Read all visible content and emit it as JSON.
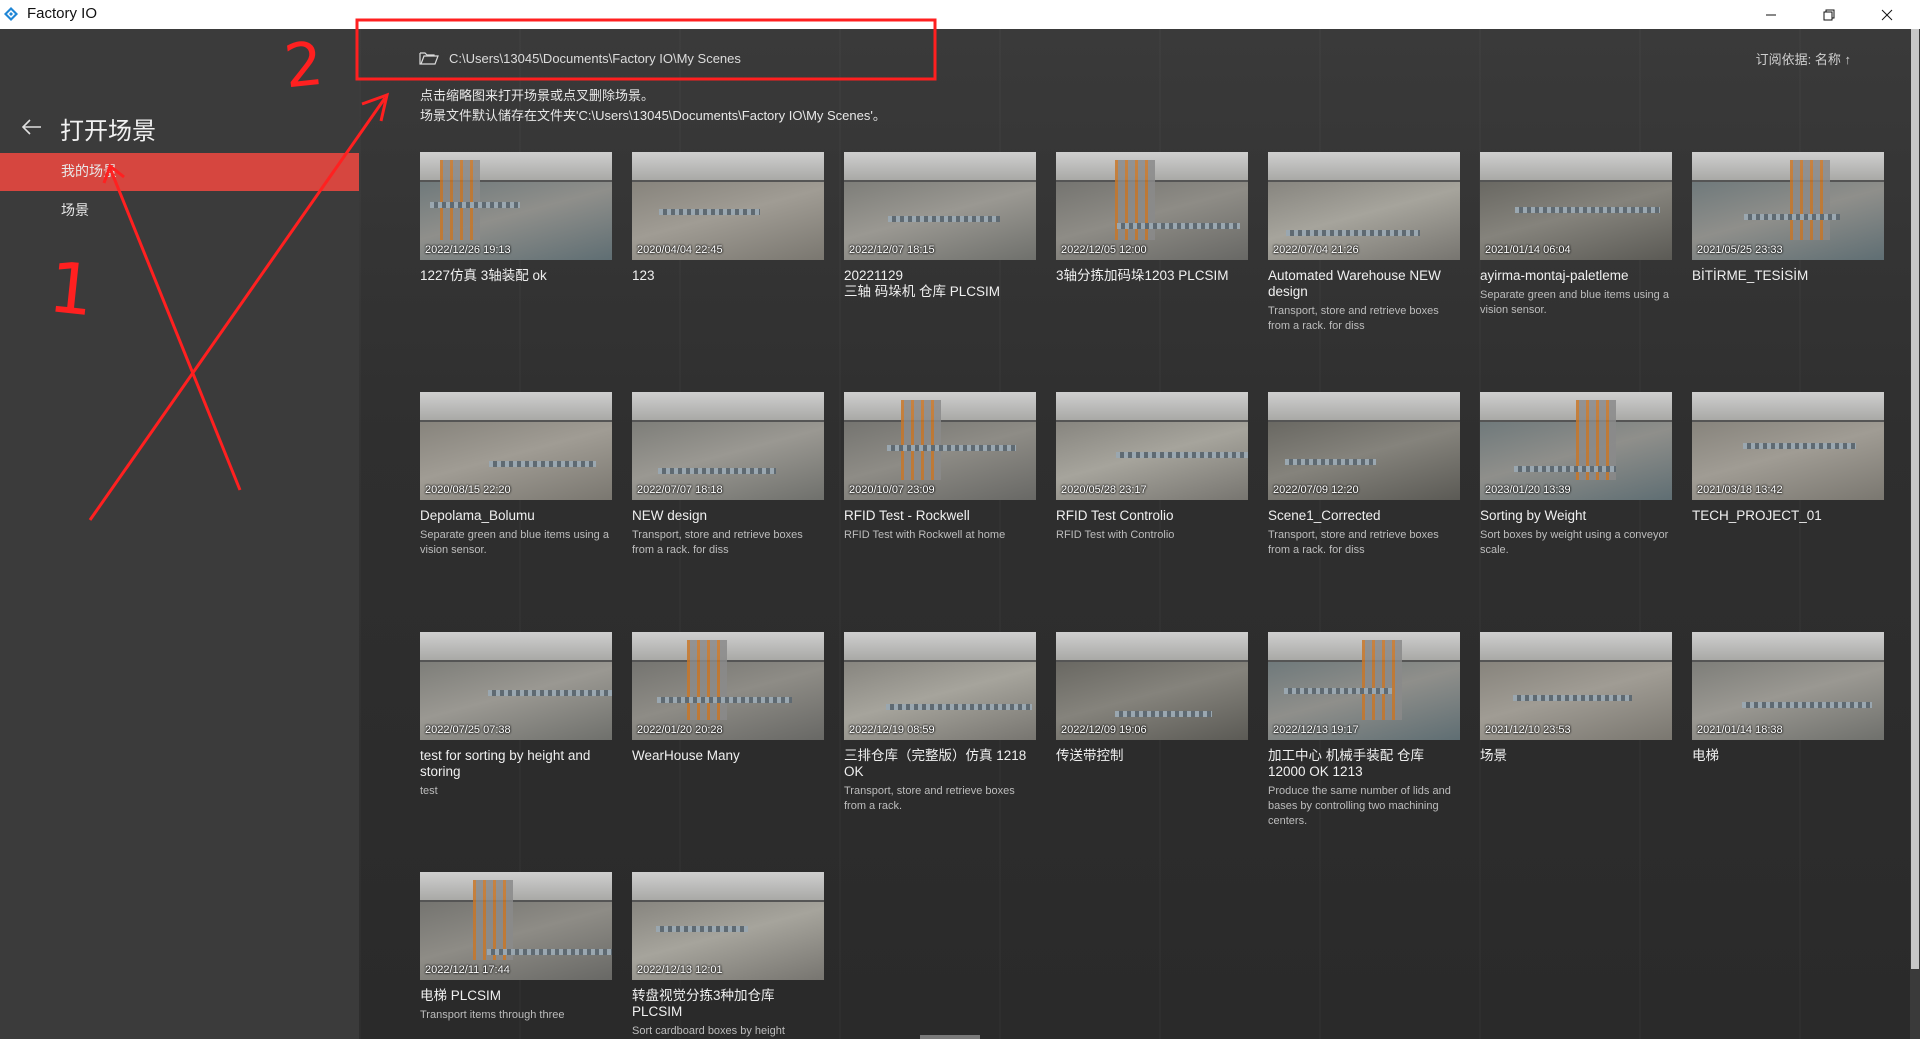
{
  "window": {
    "title": "Factory IO",
    "minimize_icon": "minimize-icon",
    "restore_icon": "restore-icon",
    "close_icon": "close-icon"
  },
  "sidebar": {
    "title": "打开场景",
    "items": [
      {
        "label": "我的场景",
        "active": true
      },
      {
        "label": "场景",
        "active": false
      }
    ]
  },
  "main": {
    "path": "C:\\Users\\13045\\Documents\\Factory IO\\My Scenes",
    "sort_label": "订阅依据: 名称 ↑",
    "info_line1": "点击缩略图来打开场景或点叉删除场景。",
    "info_line2": "场景文件默认储存在文件夹'C:\\Users\\13045\\Documents\\Factory IO\\My Scenes'。"
  },
  "scenes": [
    {
      "date": "2022/12/26 19:13",
      "title": "1227仿真 3轴装配 ok",
      "desc": ""
    },
    {
      "date": "2020/04/04 22:45",
      "title": "123",
      "desc": ""
    },
    {
      "date": "2022/12/07 18:15",
      "title": "20221129\n三轴 码垛机 仓库 PLCSIM",
      "desc": ""
    },
    {
      "date": "2022/12/05 12:00",
      "title": "3轴分拣加码垛1203 PLCSIM",
      "desc": ""
    },
    {
      "date": "2022/07/04 21:26",
      "title": "Automated Warehouse NEW design",
      "desc": "Transport, store and retrieve boxes from a rack. for diss"
    },
    {
      "date": "2021/01/14 06:04",
      "title": "ayirma-montaj-paletleme",
      "desc": "Separate green and blue items using a vision sensor."
    },
    {
      "date": "2021/05/25 23:33",
      "title": "BİTİRME_TESİSİM",
      "desc": ""
    },
    {
      "date": "2020/08/15 22:20",
      "title": "Depolama_Bolumu",
      "desc": "Separate green and blue items using a vision sensor."
    },
    {
      "date": "2022/07/07 18:18",
      "title": "NEW design",
      "desc": "Transport, store and retrieve boxes from a rack. for diss"
    },
    {
      "date": "2020/10/07 23:09",
      "title": "RFID Test - Rockwell",
      "desc": "RFID Test with Rockwell at home"
    },
    {
      "date": "2020/05/28 23:17",
      "title": "RFID Test Controlio",
      "desc": "RFID Test with Controlio"
    },
    {
      "date": "2022/07/09 12:20",
      "title": "Scene1_Corrected",
      "desc": "Transport, store and retrieve boxes from a rack. for diss"
    },
    {
      "date": "2023/01/20 13:39",
      "title": "Sorting by Weight",
      "desc": "Sort boxes by weight using a conveyor scale."
    },
    {
      "date": "2021/03/18 13:42",
      "title": "TECH_PROJECT_01",
      "desc": ""
    },
    {
      "date": "2022/07/25 07:38",
      "title": "test for sorting by height and storing",
      "desc": "test"
    },
    {
      "date": "2022/01/20 20:28",
      "title": "WearHouse Many",
      "desc": ""
    },
    {
      "date": "2022/12/19 08:59",
      "title": "三排仓库（完整版）仿真 1218 OK",
      "desc": "Transport, store and retrieve boxes from a rack."
    },
    {
      "date": "2022/12/09 19:06",
      "title": "传送带控制",
      "desc": ""
    },
    {
      "date": "2022/12/13 19:17",
      "title": "加工中心 机械手装配 仓库12000 OK 1213",
      "desc": "Produce the same number of lids and bases by controlling two machining centers."
    },
    {
      "date": "2021/12/10 23:53",
      "title": "场景",
      "desc": ""
    },
    {
      "date": "2021/01/14 18:38",
      "title": "电梯",
      "desc": ""
    },
    {
      "date": "2022/12/11 17:44",
      "title": "电梯 PLCSIM",
      "desc": "Transport items through three"
    },
    {
      "date": "2022/12/13 12:01",
      "title": "转盘视觉分拣3种加仓库 PLCSIM",
      "desc": "Sort cardboard boxes by height"
    }
  ],
  "annotations": {
    "label_1": "1",
    "label_2": "2",
    "color": "#ff2020"
  }
}
